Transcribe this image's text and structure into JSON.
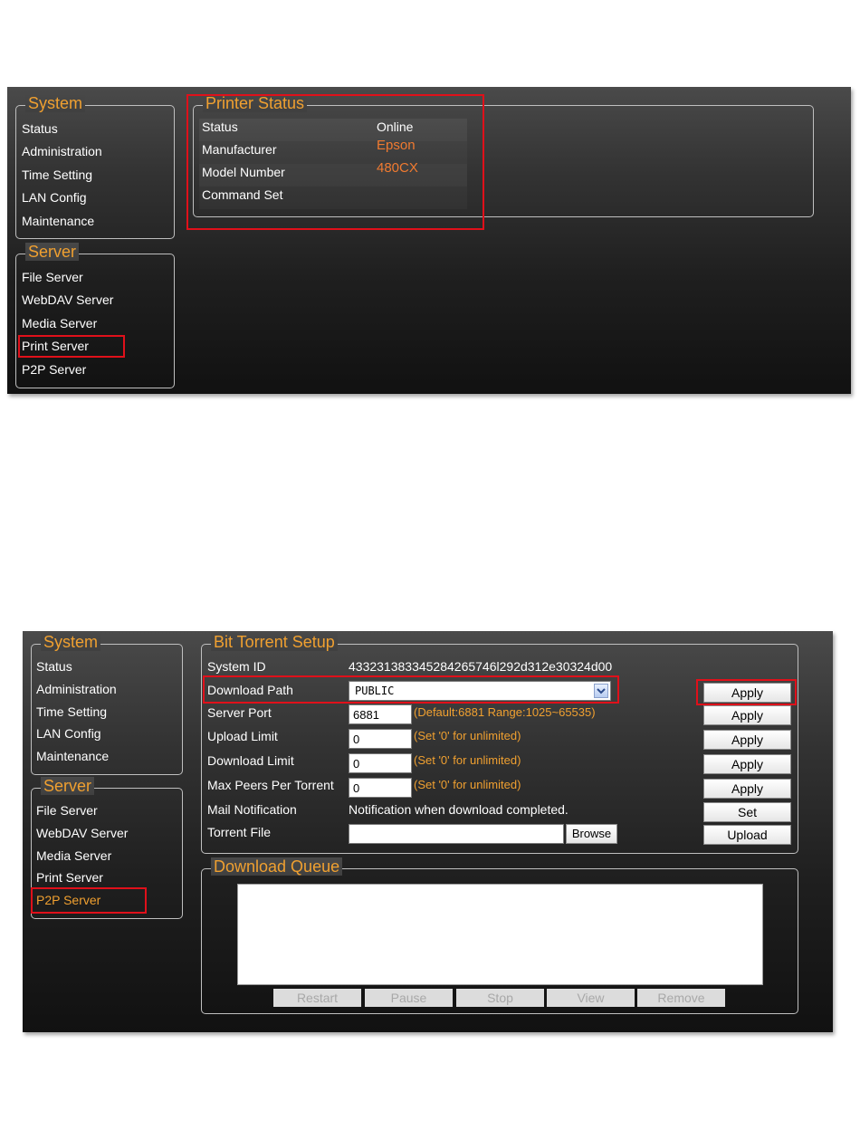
{
  "screen1": {
    "system": {
      "title": "System",
      "items": [
        "Status",
        "Administration",
        "Time Setting",
        "LAN Config",
        "Maintenance"
      ]
    },
    "server": {
      "title": "Server",
      "items": [
        "File Server",
        "WebDAV Server",
        "Media Server",
        "Print Server",
        "P2P Server"
      ]
    },
    "printer_status": {
      "title": "Printer Status",
      "rows": [
        {
          "label": "Status",
          "value": "Online"
        },
        {
          "label": "Manufacturer",
          "value": "Epson"
        },
        {
          "label": "Model Number",
          "value": "480CX"
        },
        {
          "label": "Command Set",
          "value": ""
        }
      ]
    }
  },
  "screen2": {
    "system": {
      "title": "System",
      "items": [
        "Status",
        "Administration",
        "Time Setting",
        "LAN Config",
        "Maintenance"
      ]
    },
    "server": {
      "title": "Server",
      "items": [
        "File Server",
        "WebDAV Server",
        "Media Server",
        "Print Server",
        "P2P Server"
      ]
    },
    "bit_torrent": {
      "title": "Bit Torrent Setup",
      "system_id_label": "System ID",
      "system_id_value": "433231383345284265746l292d312e30324d00",
      "download_path_label": "Download Path",
      "download_path_value": "PUBLIC",
      "server_port_label": "Server Port",
      "server_port_value": "6881",
      "server_port_hint": "(Default:6881 Range:1025~65535)",
      "upload_limit_label": "Upload Limit",
      "upload_limit_value": "0",
      "upload_limit_hint": "(Set '0' for unlimited)",
      "download_limit_label": "Download Limit",
      "download_limit_value": "0",
      "download_limit_hint": "(Set '0' for unlimited)",
      "max_peers_label": "Max Peers Per Torrent",
      "max_peers_value": "0",
      "max_peers_hint": "(Set '0' for unlimited)",
      "mail_label": "Mail Notification",
      "mail_value": "Notification when download completed.",
      "torrent_label": "Torrent File",
      "torrent_value": "",
      "browse_label": "Browse",
      "apply_label": "Apply",
      "set_label": "Set",
      "upload_label": "Upload"
    },
    "download_queue": {
      "title": "Download Queue",
      "buttons": [
        "Restart",
        "Pause",
        "Stop",
        "View",
        "Remove"
      ]
    }
  }
}
